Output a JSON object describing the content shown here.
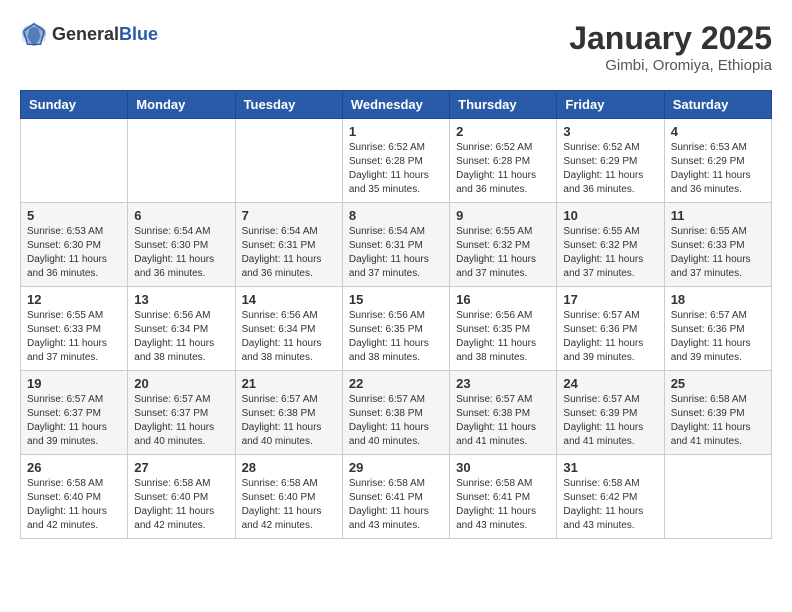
{
  "header": {
    "logo_general": "General",
    "logo_blue": "Blue",
    "month": "January 2025",
    "location": "Gimbi, Oromiya, Ethiopia"
  },
  "weekdays": [
    "Sunday",
    "Monday",
    "Tuesday",
    "Wednesday",
    "Thursday",
    "Friday",
    "Saturday"
  ],
  "weeks": [
    [
      {
        "day": "",
        "info": ""
      },
      {
        "day": "",
        "info": ""
      },
      {
        "day": "",
        "info": ""
      },
      {
        "day": "1",
        "info": "Sunrise: 6:52 AM\nSunset: 6:28 PM\nDaylight: 11 hours\nand 35 minutes."
      },
      {
        "day": "2",
        "info": "Sunrise: 6:52 AM\nSunset: 6:28 PM\nDaylight: 11 hours\nand 36 minutes."
      },
      {
        "day": "3",
        "info": "Sunrise: 6:52 AM\nSunset: 6:29 PM\nDaylight: 11 hours\nand 36 minutes."
      },
      {
        "day": "4",
        "info": "Sunrise: 6:53 AM\nSunset: 6:29 PM\nDaylight: 11 hours\nand 36 minutes."
      }
    ],
    [
      {
        "day": "5",
        "info": "Sunrise: 6:53 AM\nSunset: 6:30 PM\nDaylight: 11 hours\nand 36 minutes."
      },
      {
        "day": "6",
        "info": "Sunrise: 6:54 AM\nSunset: 6:30 PM\nDaylight: 11 hours\nand 36 minutes."
      },
      {
        "day": "7",
        "info": "Sunrise: 6:54 AM\nSunset: 6:31 PM\nDaylight: 11 hours\nand 36 minutes."
      },
      {
        "day": "8",
        "info": "Sunrise: 6:54 AM\nSunset: 6:31 PM\nDaylight: 11 hours\nand 37 minutes."
      },
      {
        "day": "9",
        "info": "Sunrise: 6:55 AM\nSunset: 6:32 PM\nDaylight: 11 hours\nand 37 minutes."
      },
      {
        "day": "10",
        "info": "Sunrise: 6:55 AM\nSunset: 6:32 PM\nDaylight: 11 hours\nand 37 minutes."
      },
      {
        "day": "11",
        "info": "Sunrise: 6:55 AM\nSunset: 6:33 PM\nDaylight: 11 hours\nand 37 minutes."
      }
    ],
    [
      {
        "day": "12",
        "info": "Sunrise: 6:55 AM\nSunset: 6:33 PM\nDaylight: 11 hours\nand 37 minutes."
      },
      {
        "day": "13",
        "info": "Sunrise: 6:56 AM\nSunset: 6:34 PM\nDaylight: 11 hours\nand 38 minutes."
      },
      {
        "day": "14",
        "info": "Sunrise: 6:56 AM\nSunset: 6:34 PM\nDaylight: 11 hours\nand 38 minutes."
      },
      {
        "day": "15",
        "info": "Sunrise: 6:56 AM\nSunset: 6:35 PM\nDaylight: 11 hours\nand 38 minutes."
      },
      {
        "day": "16",
        "info": "Sunrise: 6:56 AM\nSunset: 6:35 PM\nDaylight: 11 hours\nand 38 minutes."
      },
      {
        "day": "17",
        "info": "Sunrise: 6:57 AM\nSunset: 6:36 PM\nDaylight: 11 hours\nand 39 minutes."
      },
      {
        "day": "18",
        "info": "Sunrise: 6:57 AM\nSunset: 6:36 PM\nDaylight: 11 hours\nand 39 minutes."
      }
    ],
    [
      {
        "day": "19",
        "info": "Sunrise: 6:57 AM\nSunset: 6:37 PM\nDaylight: 11 hours\nand 39 minutes."
      },
      {
        "day": "20",
        "info": "Sunrise: 6:57 AM\nSunset: 6:37 PM\nDaylight: 11 hours\nand 40 minutes."
      },
      {
        "day": "21",
        "info": "Sunrise: 6:57 AM\nSunset: 6:38 PM\nDaylight: 11 hours\nand 40 minutes."
      },
      {
        "day": "22",
        "info": "Sunrise: 6:57 AM\nSunset: 6:38 PM\nDaylight: 11 hours\nand 40 minutes."
      },
      {
        "day": "23",
        "info": "Sunrise: 6:57 AM\nSunset: 6:38 PM\nDaylight: 11 hours\nand 41 minutes."
      },
      {
        "day": "24",
        "info": "Sunrise: 6:57 AM\nSunset: 6:39 PM\nDaylight: 11 hours\nand 41 minutes."
      },
      {
        "day": "25",
        "info": "Sunrise: 6:58 AM\nSunset: 6:39 PM\nDaylight: 11 hours\nand 41 minutes."
      }
    ],
    [
      {
        "day": "26",
        "info": "Sunrise: 6:58 AM\nSunset: 6:40 PM\nDaylight: 11 hours\nand 42 minutes."
      },
      {
        "day": "27",
        "info": "Sunrise: 6:58 AM\nSunset: 6:40 PM\nDaylight: 11 hours\nand 42 minutes."
      },
      {
        "day": "28",
        "info": "Sunrise: 6:58 AM\nSunset: 6:40 PM\nDaylight: 11 hours\nand 42 minutes."
      },
      {
        "day": "29",
        "info": "Sunrise: 6:58 AM\nSunset: 6:41 PM\nDaylight: 11 hours\nand 43 minutes."
      },
      {
        "day": "30",
        "info": "Sunrise: 6:58 AM\nSunset: 6:41 PM\nDaylight: 11 hours\nand 43 minutes."
      },
      {
        "day": "31",
        "info": "Sunrise: 6:58 AM\nSunset: 6:42 PM\nDaylight: 11 hours\nand 43 minutes."
      },
      {
        "day": "",
        "info": ""
      }
    ]
  ],
  "shaded_weeks": [
    1,
    3
  ]
}
